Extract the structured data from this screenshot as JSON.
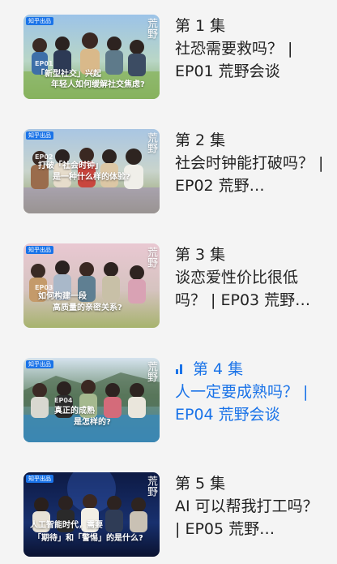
{
  "episodes": [
    {
      "title": "第 1 集",
      "name": "社恐需要救吗？ | EP01 荒野会谈",
      "thumb_badge": "知乎出品",
      "thumb_series": "荒野",
      "thumb_ep": "EP01",
      "thumb_caption_1": "「新型社交」兴起",
      "thumb_caption_2": "年轻人如何缓解社交焦虑?"
    },
    {
      "title": "第 2 集",
      "name": "社会时钟能打破吗？ | EP02 荒野…",
      "thumb_badge": "知乎出品",
      "thumb_series": "荒野",
      "thumb_ep": "EP02",
      "thumb_caption_1": "打破「社会时钟」",
      "thumb_caption_2": "是一种什么样的体验?"
    },
    {
      "title": "第 3 集",
      "name": "谈恋爱性价比很低吗？ | EP03 荒野…",
      "thumb_badge": "知乎出品",
      "thumb_series": "荒野",
      "thumb_ep": "EP03",
      "thumb_caption_1": "如何构建一段",
      "thumb_caption_2": "高质量的亲密关系?"
    },
    {
      "title": "第 4 集",
      "name": "人一定要成熟吗？ | EP04 荒野会谈",
      "thumb_badge": "知乎出品",
      "thumb_series": "荒野",
      "thumb_ep": "EP04",
      "thumb_caption_1": "真正的成熟",
      "thumb_caption_2": "是怎样的?"
    },
    {
      "title": "第 5 集",
      "name": "AI 可以帮我打工吗？ | EP05 荒野…",
      "thumb_badge": "知乎出品",
      "thumb_series": "荒野",
      "thumb_ep": "EP05",
      "thumb_caption_1": "人工智能时代，需要",
      "thumb_caption_2": "「期待」和「警惕」的是什么?"
    }
  ],
  "active_index": 3,
  "colors": {
    "active": "#1a73e8",
    "text": "#222222",
    "background": "#f4f4f4"
  },
  "icons": {
    "playing": "playing-bars-icon"
  }
}
